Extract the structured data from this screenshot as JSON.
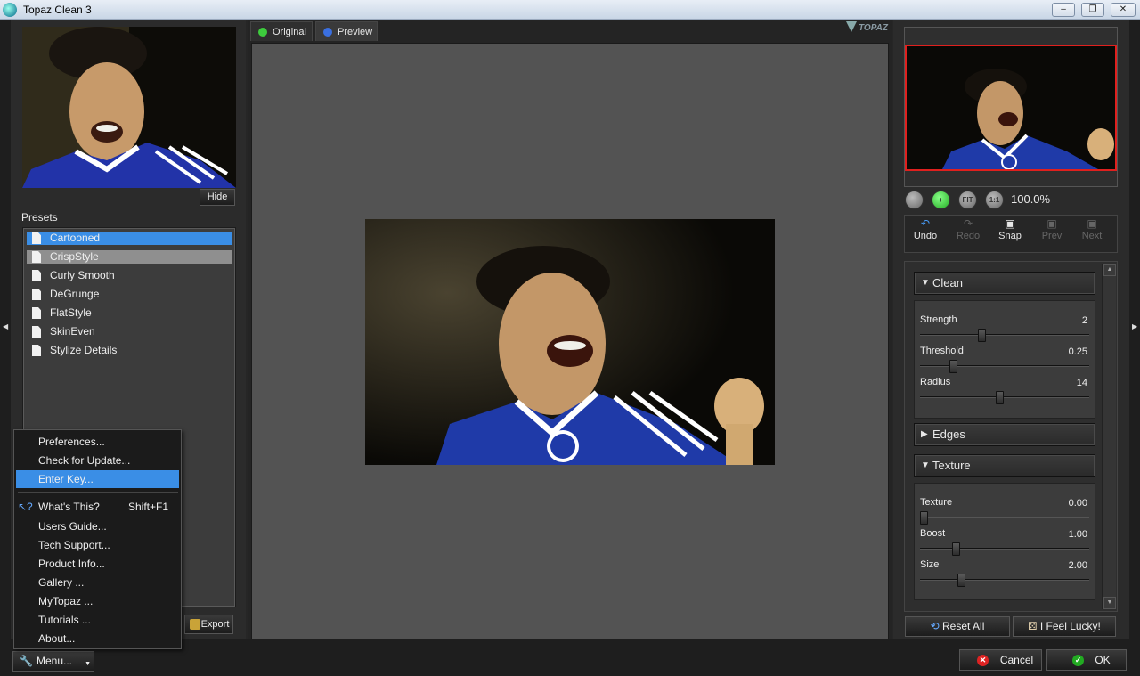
{
  "window": {
    "title": "Topaz Clean 3",
    "buttons": [
      "‒",
      "❐",
      "✕"
    ]
  },
  "left_panel": {
    "hide_label": "Hide",
    "presets_label": "Presets",
    "presets": [
      "Cartooned",
      "CrispStyle",
      "Curly Smooth",
      "DeGrunge",
      "FlatStyle",
      "SkinEven",
      "Stylize Details"
    ],
    "selected_preset": "Cartooned",
    "hover_preset": "CrispStyle",
    "export_label": "Export"
  },
  "view_tabs": {
    "original": "Original",
    "preview": "Preview"
  },
  "brand": {
    "logo": "TOPAZ LABS"
  },
  "navigator": {
    "zoom_buttons": [
      "zoom-out",
      "zoom-in",
      "FIT",
      "1:1"
    ],
    "zoom_value": "100.0%"
  },
  "actions": {
    "undo": "Undo",
    "redo": "Redo",
    "snap": "Snap",
    "prev": "Prev",
    "next": "Next"
  },
  "settings": {
    "clean": {
      "title": "Clean",
      "sliders": [
        {
          "label": "Strength",
          "value": "2",
          "fraction": 0.36
        },
        {
          "label": "Threshold",
          "value": "0.25",
          "fraction": 0.18
        },
        {
          "label": "Radius",
          "value": "14",
          "fraction": 0.47
        }
      ]
    },
    "edges": {
      "title": "Edges"
    },
    "texture": {
      "title": "Texture",
      "sliders": [
        {
          "label": "Texture",
          "value": "0.00",
          "fraction": 0.0
        },
        {
          "label": "Boost",
          "value": "1.00",
          "fraction": 0.2
        },
        {
          "label": "Size",
          "value": "2.00",
          "fraction": 0.23
        }
      ]
    }
  },
  "footer": {
    "reset_all": "Reset All",
    "feel_lucky": "I Feel Lucky!",
    "menu": "Menu...",
    "cancel": "Cancel",
    "ok": "OK"
  },
  "dropdown_menu": {
    "items": [
      {
        "label": "Preferences...",
        "shortcut": ""
      },
      {
        "label": "Check for Update...",
        "shortcut": ""
      },
      {
        "label": "Enter Key...",
        "shortcut": ""
      },
      {
        "label": "What's This?",
        "shortcut": "Shift+F1"
      },
      {
        "label": "Users Guide...",
        "shortcut": ""
      },
      {
        "label": "Tech Support...",
        "shortcut": ""
      },
      {
        "label": "Product Info...",
        "shortcut": ""
      },
      {
        "label": "Gallery ...",
        "shortcut": ""
      },
      {
        "label": "MyTopaz ...",
        "shortcut": ""
      },
      {
        "label": "Tutorials ...",
        "shortcut": ""
      },
      {
        "label": "About...",
        "shortcut": ""
      }
    ],
    "selected": "Enter Key..."
  },
  "colors": {
    "selection": "#3a8ee6",
    "nav_frame": "#e0201e",
    "jersey": "#1f3aa8"
  }
}
